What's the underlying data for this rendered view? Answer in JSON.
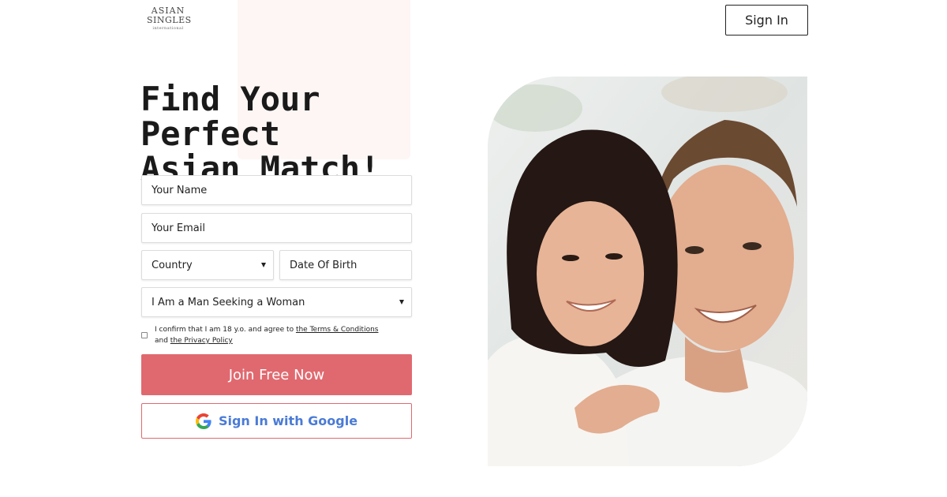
{
  "logo": {
    "line1": "ASIAN",
    "line2": "SINGLES",
    "line3": "international"
  },
  "header": {
    "signin_label": "Sign In"
  },
  "hero": {
    "headline_line1": "Find Your Perfect",
    "headline_line2": "Asian Match!"
  },
  "form": {
    "name_placeholder": "Your Name",
    "email_placeholder": "Your Email",
    "country_label": "Country",
    "dob_placeholder": "Date Of Birth",
    "seeking_value": "I Am a Man Seeking a Woman",
    "consent_prefix": "I confirm that I am 18 y.o. and agree to ",
    "terms_link": "the Terms & Conditions",
    "consent_mid": " and ",
    "privacy_link": "the Privacy Policy",
    "join_label": "Join Free Now",
    "google_label": "Sign In with Google"
  },
  "colors": {
    "accent": "#e0696f",
    "google_text": "#4a7bd6",
    "panel_bg": "#fdf6f4"
  },
  "icons": {
    "google": "google-g-icon",
    "dropdown": "chevron-down-icon"
  }
}
